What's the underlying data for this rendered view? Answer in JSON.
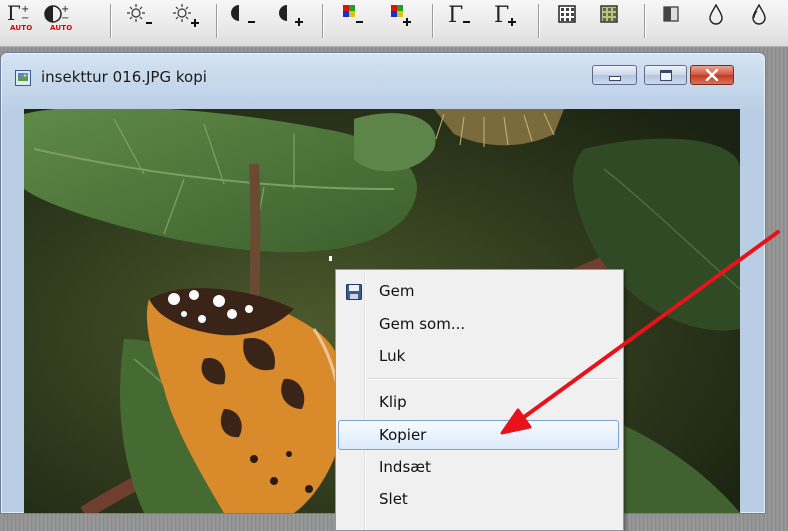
{
  "toolbar": {
    "auto_label_1": "AUTO",
    "auto_label_2": "AUTO",
    "buttons": [
      "gamma-auto-icon",
      "contrast-auto-icon",
      "brightness-decrease-icon",
      "brightness-increase-icon",
      "contrast-decrease-icon",
      "contrast-increase-icon",
      "color-decrease-icon",
      "color-increase-icon",
      "gamma-decrease-icon",
      "gamma-increase-icon",
      "grid-icon",
      "grid-color-icon",
      "shade-icon",
      "drop-outline-icon",
      "drops-icon"
    ]
  },
  "window": {
    "title": "insekttur 016.JPG kopi"
  },
  "context_menu": {
    "items": [
      {
        "label": "Gem",
        "icon": "floppy-disk-icon"
      },
      {
        "label": "Gem som..."
      },
      {
        "label": "Luk"
      },
      {
        "label": "Klip"
      },
      {
        "label": "Kopier",
        "highlighted": true
      },
      {
        "label": "Indsæt"
      },
      {
        "label": "Slet"
      }
    ]
  },
  "colors": {
    "annotation_arrow": "#e8121a",
    "menu_highlight": "#dcebfc"
  }
}
